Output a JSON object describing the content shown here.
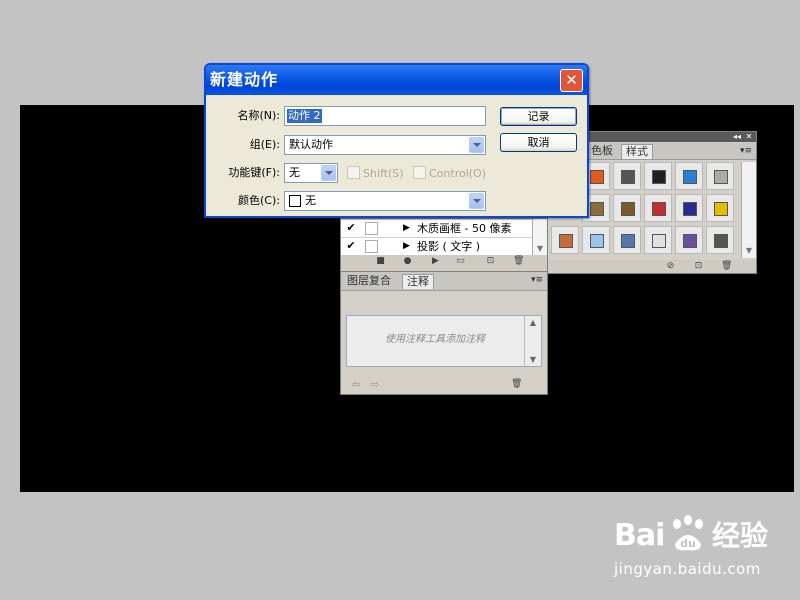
{
  "colors": {
    "desktop": "#c3c3c3",
    "canvas": "#000000",
    "titlebar": "#0a56e2",
    "close": "#e0563b",
    "dialog_bg": "#ece9d8"
  },
  "dialog": {
    "title": "新建动作",
    "close_icon": "close-x",
    "name": {
      "label": "名称(N):",
      "value": "动作 2"
    },
    "group": {
      "label": "组(E):",
      "value": "默认动作"
    },
    "function_key": {
      "label": "功能键(F):",
      "value": "无",
      "shift_label": "Shift(S)",
      "control_label": "Control(O)"
    },
    "color": {
      "label": "颜色(C):",
      "value": "无"
    },
    "buttons": {
      "record": "记录",
      "cancel": "取消"
    }
  },
  "styles_panel": {
    "tabs": [
      "色板",
      "样式"
    ],
    "active_tab": "样式",
    "swatches": [
      [
        "#e8591c",
        "#555555",
        "#202020",
        "#2a7fd0",
        "#aaaaaa"
      ],
      [
        "#8a6d3b",
        "#7d5a2e",
        "#c03030",
        "#2a2a90",
        "#e0c000"
      ],
      [
        "#c46b3c",
        "#9ac4ea",
        "#5577aa",
        "#e0e0e0",
        "#6a4fa0",
        "#555555"
      ]
    ]
  },
  "actions_panel": {
    "items": [
      {
        "label": "木质画框 - 50 像素",
        "checked": true
      },
      {
        "label": "投影 ( 文字 )",
        "checked": true
      }
    ]
  },
  "notes_panel": {
    "tabs": [
      "图层复合",
      "注释"
    ],
    "active_tab": "注释",
    "placeholder": "使用注释工具添加注释"
  },
  "watermark": {
    "brand": "Bai",
    "brand_suffix": "du",
    "product": "经验",
    "url": "jingyan.baidu.com"
  }
}
